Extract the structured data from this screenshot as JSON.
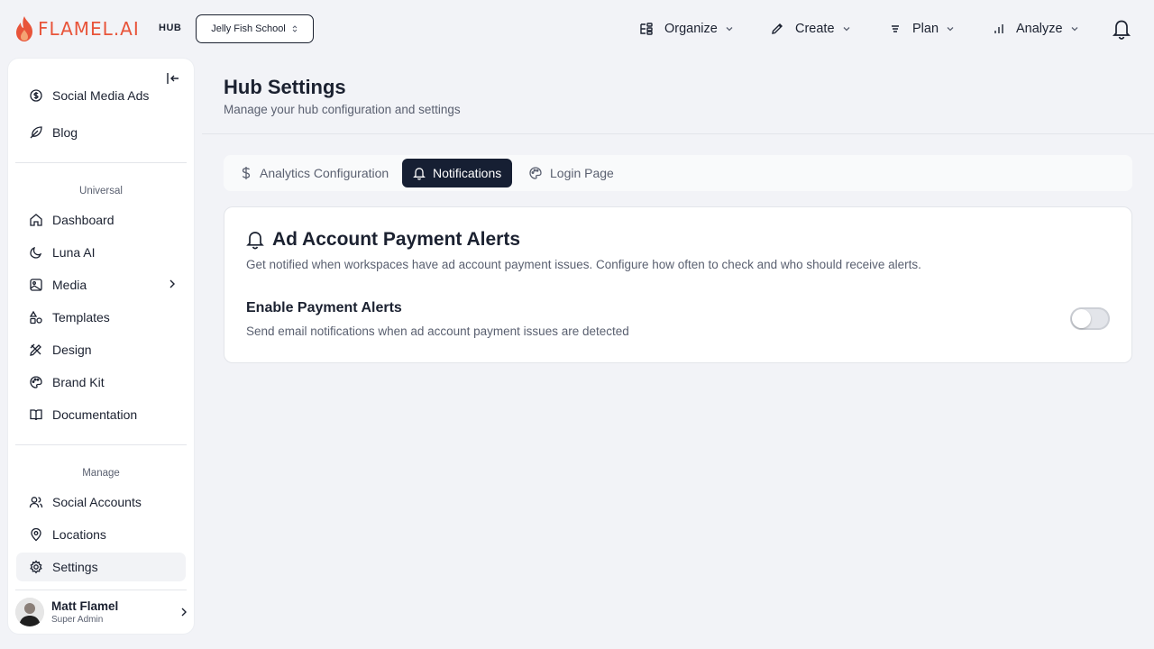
{
  "brand": {
    "name": "FLAMEL.AI",
    "hub_label": "HUB",
    "accent": "#e8543a"
  },
  "workspace_select": {
    "value": "Jelly Fish School"
  },
  "topnav": {
    "organize": "Organize",
    "create": "Create",
    "plan": "Plan",
    "analyze": "Analyze"
  },
  "sidebar": {
    "top_items": [
      {
        "label": "Social Media Ads",
        "icon": "dollar-badge-icon"
      },
      {
        "label": "Blog",
        "icon": "feather-icon"
      }
    ],
    "universal": {
      "title": "Universal",
      "items": [
        {
          "label": "Dashboard",
          "icon": "home-icon"
        },
        {
          "label": "Luna AI",
          "icon": "moon-icon"
        },
        {
          "label": "Media",
          "icon": "image-icon"
        },
        {
          "label": "Templates",
          "icon": "shapes-icon"
        },
        {
          "label": "Design",
          "icon": "design-tools-icon"
        },
        {
          "label": "Brand Kit",
          "icon": "palette-icon"
        },
        {
          "label": "Documentation",
          "icon": "book-icon"
        }
      ]
    },
    "manage": {
      "title": "Manage",
      "items": [
        {
          "label": "Social Accounts",
          "icon": "users-icon"
        },
        {
          "label": "Locations",
          "icon": "map-pin-icon"
        },
        {
          "label": "Settings",
          "icon": "gear-icon"
        }
      ]
    },
    "user": {
      "name": "Matt Flamel",
      "role": "Super Admin"
    }
  },
  "page": {
    "title": "Hub Settings",
    "subtitle": "Manage your hub configuration and settings"
  },
  "tabs": [
    {
      "label": "Analytics Configuration",
      "icon": "dollar-icon"
    },
    {
      "label": "Notifications",
      "icon": "bell-icon"
    },
    {
      "label": "Login Page",
      "icon": "palette-icon"
    }
  ],
  "active_tab": "Notifications",
  "card": {
    "title": "Ad Account Payment Alerts",
    "description": "Get notified when workspaces have ad account payment issues. Configure how often to check and who should receive alerts.",
    "option": {
      "title": "Enable Payment Alerts",
      "description": "Send email notifications when ad account payment issues are detected",
      "enabled": false
    }
  },
  "colors": {
    "active_tab_bg": "#161f33",
    "text": "#1b2130",
    "muted": "#5a6070"
  }
}
